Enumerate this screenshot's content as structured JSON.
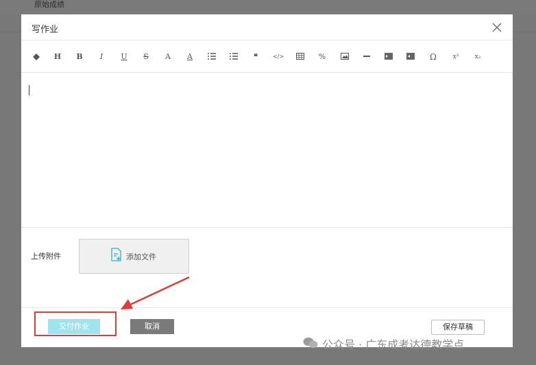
{
  "background": {
    "header_text": "原始成绩"
  },
  "modal": {
    "title": "写作业",
    "close_icon": "close-icon"
  },
  "toolbar": {
    "buttons": [
      {
        "name": "eraser-icon",
        "glyph": "◆"
      },
      {
        "name": "heading-icon",
        "glyph": "H"
      },
      {
        "name": "bold-icon",
        "glyph": "B"
      },
      {
        "name": "italic-icon",
        "glyph": "I"
      },
      {
        "name": "underline-icon",
        "glyph": "U"
      },
      {
        "name": "strikethrough-icon",
        "glyph": "S"
      },
      {
        "name": "font-color-icon",
        "glyph": "A"
      },
      {
        "name": "background-color-icon",
        "glyph": "A"
      },
      {
        "name": "ordered-list-icon",
        "glyph": ""
      },
      {
        "name": "unordered-list-icon",
        "glyph": ""
      },
      {
        "name": "quote-icon",
        "glyph": "❝"
      },
      {
        "name": "code-icon",
        "glyph": "</>"
      },
      {
        "name": "table-icon",
        "glyph": ""
      },
      {
        "name": "link-icon",
        "glyph": "%"
      },
      {
        "name": "image-icon",
        "glyph": ""
      },
      {
        "name": "horizontal-rule-icon",
        "glyph": "—"
      },
      {
        "name": "indent-icon",
        "glyph": ""
      },
      {
        "name": "outdent-icon",
        "glyph": ""
      },
      {
        "name": "special-char-icon",
        "glyph": "Ω"
      },
      {
        "name": "superscript-icon",
        "glyph": "x²"
      },
      {
        "name": "subscript-icon",
        "glyph": "x₂"
      }
    ]
  },
  "editor": {
    "content": ""
  },
  "attachment": {
    "label": "上传附件",
    "add_file_label": "添加文件"
  },
  "footer": {
    "submit_label": "交付作业",
    "cancel_label": "取消",
    "save_draft_label": "保存草稿"
  },
  "watermark": {
    "text": "公众号 · 广东成考达德教学点"
  },
  "colors": {
    "accent_disabled": "#9fe3ec",
    "highlight": "#e53935",
    "overlay": "#787878"
  }
}
